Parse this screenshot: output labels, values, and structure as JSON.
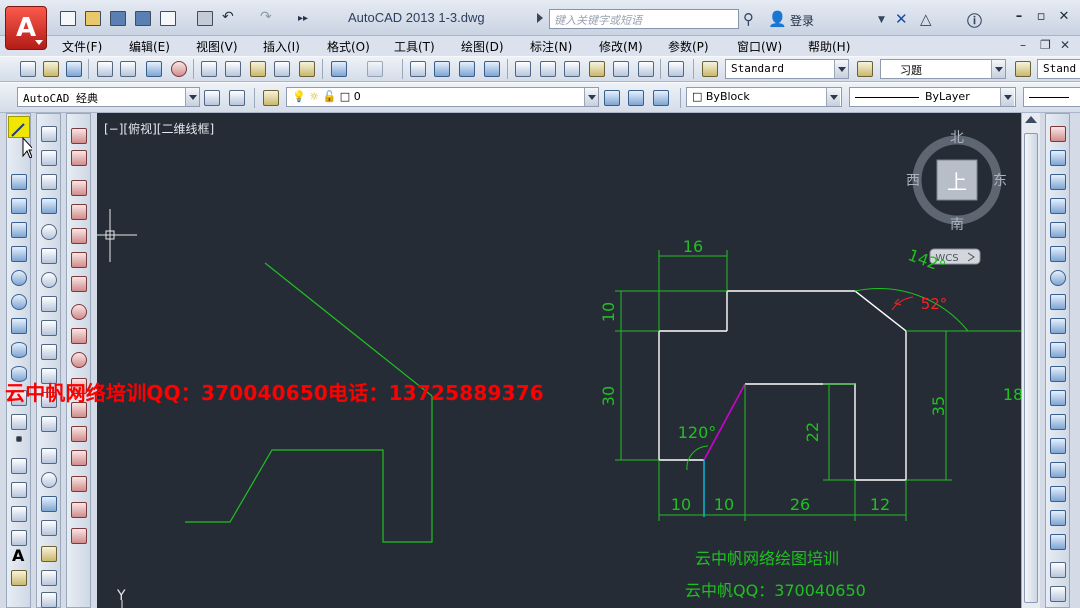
{
  "window": {
    "title": "AutoCAD 2013    1-3.dwg",
    "search_placeholder": "键入关键字或短语",
    "login_label": "登录",
    "app_letter": "A"
  },
  "menu": [
    "文件(F)",
    "编辑(E)",
    "视图(V)",
    "插入(I)",
    "格式(O)",
    "工具(T)",
    "绘图(D)",
    "标注(N)",
    "修改(M)",
    "参数(P)",
    "窗口(W)",
    "帮助(H)"
  ],
  "toolbar": {
    "text_style": "Standard",
    "dim_style": "习题",
    "table_style": "Stand",
    "workspace": "AutoCAD 经典",
    "layer": "0",
    "color": "ByBlock",
    "linetype": "ByLayer"
  },
  "viewport": {
    "label": "[−][俯视][二维线框]",
    "viewcube": {
      "top_face": "上",
      "north": "北",
      "south": "南",
      "east": "东",
      "west": "西",
      "wcs": "WCS"
    },
    "ucs_y": "Y"
  },
  "dimensions": {
    "top_width": "16",
    "left_top_height": "10",
    "left_height": "30",
    "right_height": "35",
    "inner_height": "22",
    "angle_small": "52°",
    "angle_top": "142°",
    "angle_left": "120°",
    "bottom_1": "10",
    "bottom_2": "10",
    "bottom_3": "26",
    "bottom_4": "12",
    "far_right": "18"
  },
  "watermark": "云中帆网络培训QQ：370040650电话：13725889376",
  "captions": {
    "line1": "云中帆网络绘图培训",
    "line2": "云中帆QQ：370040650"
  },
  "colors": {
    "canvas_bg": "#262c36",
    "geometry": "#ffffff",
    "dimension": "#20c020",
    "highlight": "#d000d0",
    "angle_red": "#ff2020",
    "watermark": "#ff0000"
  }
}
